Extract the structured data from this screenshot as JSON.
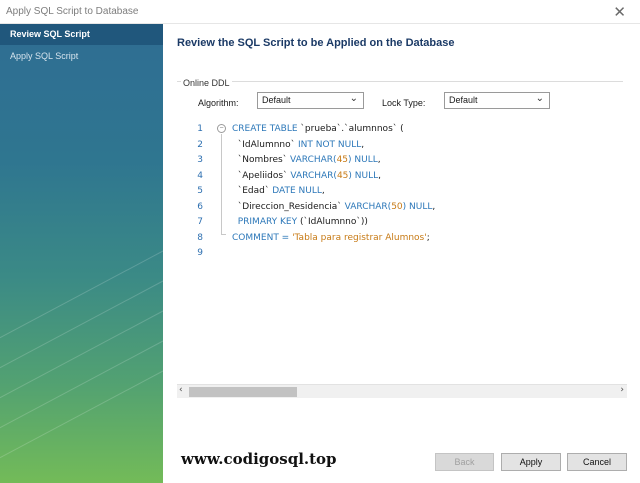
{
  "window": {
    "title": "Apply SQL Script to Database",
    "close_glyph": "✕"
  },
  "sidebar": {
    "steps": [
      {
        "label": "Review SQL Script",
        "active": true
      },
      {
        "label": "Apply SQL Script",
        "active": false
      }
    ]
  },
  "main": {
    "title": "Review the SQL Script to be Applied on the Database"
  },
  "online_ddl": {
    "legend": "Online DDL",
    "algorithm_label": "Algorithm:",
    "algorithm_value": "Default",
    "lock_type_label": "Lock Type:",
    "lock_type_value": "Default"
  },
  "editor": {
    "line_numbers": [
      "1",
      "2",
      "3",
      "4",
      "5",
      "6",
      "7",
      "8",
      "9"
    ],
    "lines": [
      [
        {
          "t": "CREATE TABLE ",
          "c": "kw"
        },
        {
          "t": "`prueba`.`alumnnos` (",
          "c": ""
        }
      ],
      [
        {
          "t": "  `IdAlumnno` ",
          "c": ""
        },
        {
          "t": "INT NOT NULL",
          "c": "kw"
        },
        {
          "t": ",",
          "c": ""
        }
      ],
      [
        {
          "t": "  `Nombres` ",
          "c": ""
        },
        {
          "t": "VARCHAR(",
          "c": "kw"
        },
        {
          "t": "45",
          "c": "num"
        },
        {
          "t": ") NULL",
          "c": "kw"
        },
        {
          "t": ",",
          "c": ""
        }
      ],
      [
        {
          "t": "  `Apeliidos` ",
          "c": ""
        },
        {
          "t": "VARCHAR(",
          "c": "kw"
        },
        {
          "t": "45",
          "c": "num"
        },
        {
          "t": ") NULL",
          "c": "kw"
        },
        {
          "t": ",",
          "c": ""
        }
      ],
      [
        {
          "t": "  `Edad` ",
          "c": ""
        },
        {
          "t": "DATE NULL",
          "c": "kw"
        },
        {
          "t": ",",
          "c": ""
        }
      ],
      [
        {
          "t": "  `Direccion_Residencia` ",
          "c": ""
        },
        {
          "t": "VARCHAR(",
          "c": "kw"
        },
        {
          "t": "50",
          "c": "num"
        },
        {
          "t": ") NULL",
          "c": "kw"
        },
        {
          "t": ",",
          "c": ""
        }
      ],
      [
        {
          "t": "  PRIMARY KEY ",
          "c": "kw"
        },
        {
          "t": "(`IdAlumnno`))",
          "c": ""
        }
      ],
      [
        {
          "t": "COMMENT = ",
          "c": "kw"
        },
        {
          "t": "'Tabla para registrar Alumnos'",
          "c": "str"
        },
        {
          "t": ";",
          "c": ""
        }
      ],
      []
    ]
  },
  "scrollbar": {
    "left_arrow": "‹",
    "right_arrow": "›"
  },
  "watermark": "www.codigosql.top",
  "buttons": {
    "back": "Back",
    "apply": "Apply",
    "cancel": "Cancel"
  },
  "colors": {
    "keyword": "#2d78b9",
    "number": "#c77a15",
    "string": "#c77a15",
    "sidebar_active": "#20577c",
    "title": "#1b3a66"
  }
}
